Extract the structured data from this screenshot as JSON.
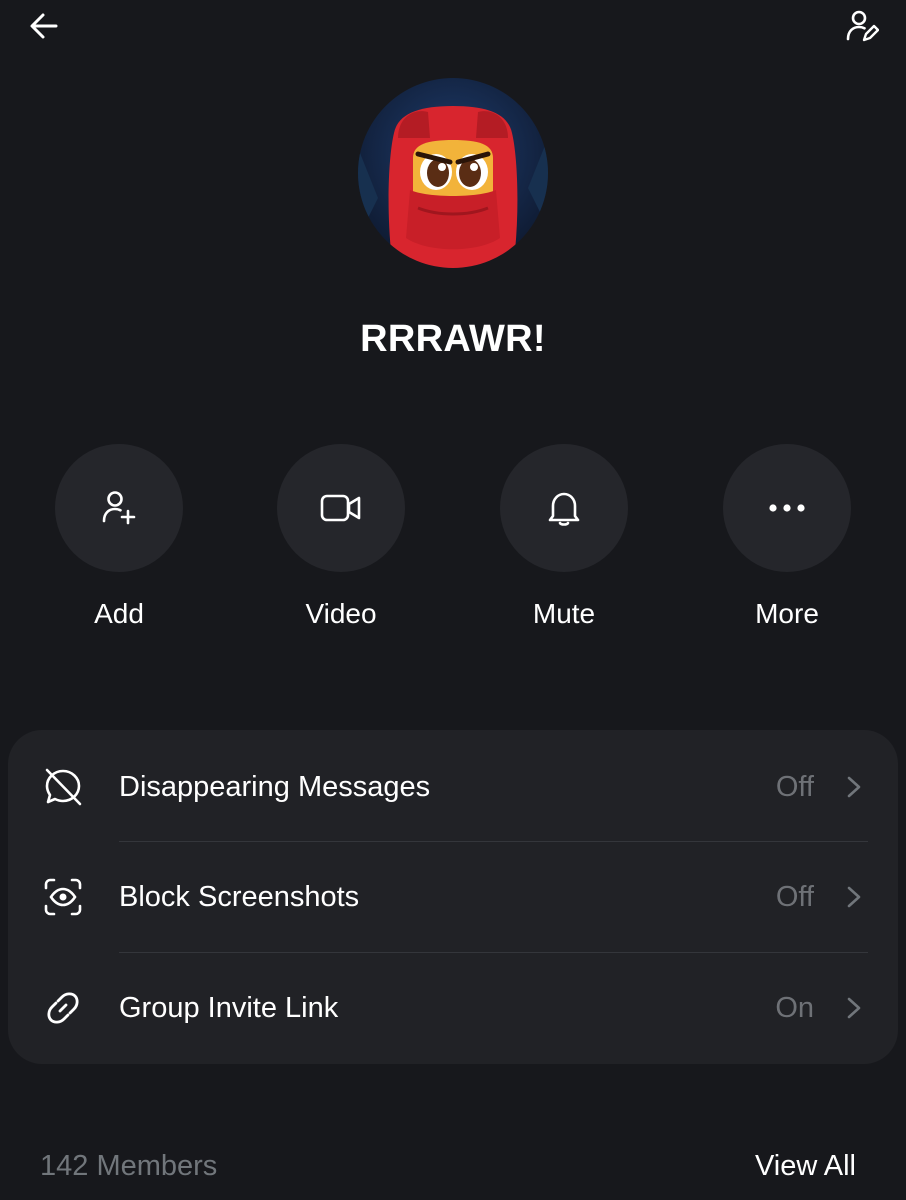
{
  "header": {
    "back_icon": "arrow-left-icon",
    "edit_icon": "person-edit-icon"
  },
  "group": {
    "name": "RRRAWR!",
    "avatar": "red-hooded-ninja-avatar"
  },
  "actions": [
    {
      "label": "Add",
      "icon": "add-person-icon"
    },
    {
      "label": "Video",
      "icon": "video-camera-icon"
    },
    {
      "label": "Mute",
      "icon": "bell-icon"
    },
    {
      "label": "More",
      "icon": "more-dots-icon"
    }
  ],
  "settings": [
    {
      "label": "Disappearing Messages",
      "value": "Off",
      "icon": "disappearing-message-icon"
    },
    {
      "label": "Block Screenshots",
      "value": "Off",
      "icon": "screenshot-block-icon"
    },
    {
      "label": "Group Invite Link",
      "value": "On",
      "icon": "link-icon"
    }
  ],
  "members": {
    "count_label": "142 Members",
    "view_all_label": "View All"
  },
  "colors": {
    "background": "#17181c",
    "card": "#212226",
    "action_circle": "#25262b",
    "muted_text": "#71767b",
    "avatar_red": "#d8252e"
  }
}
